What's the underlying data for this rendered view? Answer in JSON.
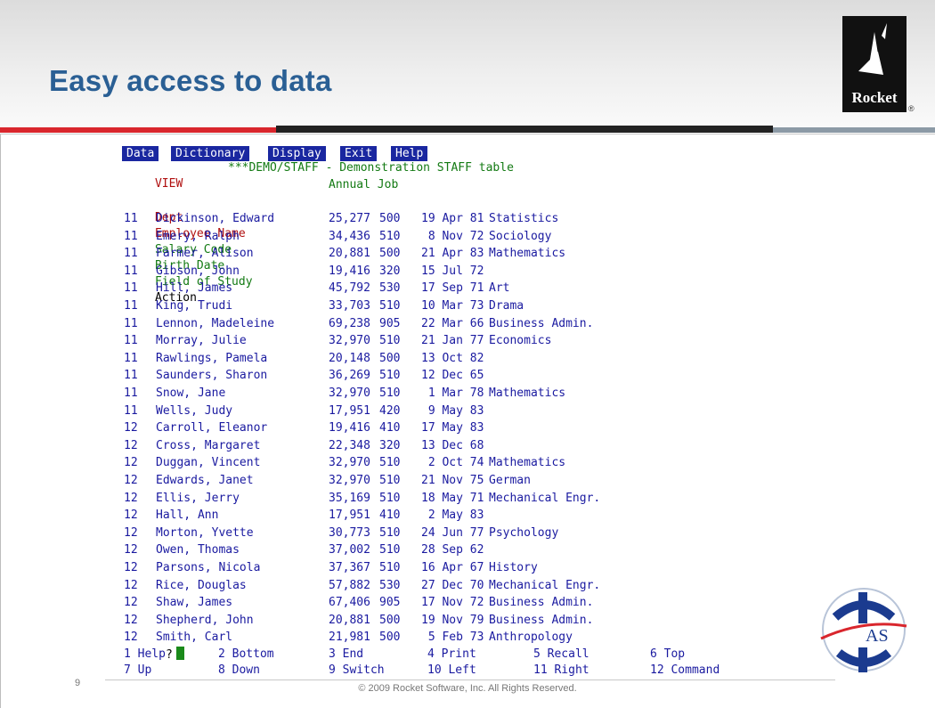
{
  "slide": {
    "title": "Easy access to data",
    "page_number": "9",
    "copyright": "© 2009 Rocket Software, Inc. All Rights Reserved.",
    "logo_text": "Rocket",
    "logo_mark": "®",
    "emblem_text": "AS"
  },
  "terminal": {
    "menu": [
      "Data",
      "Dictionary",
      "Display",
      "Exit",
      "Help"
    ],
    "mode": "VIEW",
    "table_title": "***DEMO/STAFF - Demonstration STAFF table",
    "header_top": "Annual Job",
    "columns": {
      "dept": "Dept",
      "name": "Employee Name",
      "salary_code": "Salary Code",
      "birth_date": "Birth Date",
      "field": "Field of Study",
      "action": "Action"
    },
    "rows": [
      {
        "dept": "11",
        "name": "Dickinson, Edward",
        "salary": "25,277",
        "code": "500",
        "birth": "19 Apr 81",
        "field": "Statistics"
      },
      {
        "dept": "11",
        "name": "Emery, Ralph",
        "salary": "34,436",
        "code": "510",
        "birth": " 8 Nov 72",
        "field": "Sociology"
      },
      {
        "dept": "11",
        "name": "Farmer, Alison",
        "salary": "20,881",
        "code": "500",
        "birth": "21 Apr 83",
        "field": "Mathematics"
      },
      {
        "dept": "11",
        "name": "Gibson, John",
        "salary": "19,416",
        "code": "320",
        "birth": "15 Jul 72",
        "field": ""
      },
      {
        "dept": "11",
        "name": "Hill, James",
        "salary": "45,792",
        "code": "530",
        "birth": "17 Sep 71",
        "field": "Art"
      },
      {
        "dept": "11",
        "name": "King, Trudi",
        "salary": "33,703",
        "code": "510",
        "birth": "10 Mar 73",
        "field": "Drama"
      },
      {
        "dept": "11",
        "name": "Lennon, Madeleine",
        "salary": "69,238",
        "code": "905",
        "birth": "22 Mar 66",
        "field": "Business Admin."
      },
      {
        "dept": "11",
        "name": "Morray, Julie",
        "salary": "32,970",
        "code": "510",
        "birth": "21 Jan 77",
        "field": "Economics"
      },
      {
        "dept": "11",
        "name": "Rawlings, Pamela",
        "salary": "20,148",
        "code": "500",
        "birth": "13 Oct 82",
        "field": ""
      },
      {
        "dept": "11",
        "name": "Saunders, Sharon",
        "salary": "36,269",
        "code": "510",
        "birth": "12 Dec 65",
        "field": ""
      },
      {
        "dept": "11",
        "name": "Snow, Jane",
        "salary": "32,970",
        "code": "510",
        "birth": " 1 Mar 78",
        "field": "Mathematics"
      },
      {
        "dept": "11",
        "name": "Wells, Judy",
        "salary": "17,951",
        "code": "420",
        "birth": " 9 May 83",
        "field": ""
      },
      {
        "dept": "12",
        "name": "Carroll, Eleanor",
        "salary": "19,416",
        "code": "410",
        "birth": "17 May 83",
        "field": ""
      },
      {
        "dept": "12",
        "name": "Cross, Margaret",
        "salary": "22,348",
        "code": "320",
        "birth": "13 Dec 68",
        "field": ""
      },
      {
        "dept": "12",
        "name": "Duggan, Vincent",
        "salary": "32,970",
        "code": "510",
        "birth": " 2 Oct 74",
        "field": "Mathematics"
      },
      {
        "dept": "12",
        "name": "Edwards, Janet",
        "salary": "32,970",
        "code": "510",
        "birth": "21 Nov 75",
        "field": "German"
      },
      {
        "dept": "12",
        "name": "Ellis, Jerry",
        "salary": "35,169",
        "code": "510",
        "birth": "18 May 71",
        "field": "Mechanical Engr."
      },
      {
        "dept": "12",
        "name": "Hall, Ann",
        "salary": "17,951",
        "code": "410",
        "birth": " 2 May 83",
        "field": ""
      },
      {
        "dept": "12",
        "name": "Morton, Yvette",
        "salary": "30,773",
        "code": "510",
        "birth": "24 Jun 77",
        "field": "Psychology"
      },
      {
        "dept": "12",
        "name": "Owen, Thomas",
        "salary": "37,002",
        "code": "510",
        "birth": "28 Sep 62",
        "field": ""
      },
      {
        "dept": "12",
        "name": "Parsons, Nicola",
        "salary": "37,367",
        "code": "510",
        "birth": "16 Apr 67",
        "field": "History"
      },
      {
        "dept": "12",
        "name": "Rice, Douglas",
        "salary": "57,882",
        "code": "530",
        "birth": "27 Dec 70",
        "field": "Mechanical Engr."
      },
      {
        "dept": "12",
        "name": "Shaw, James",
        "salary": "67,406",
        "code": "905",
        "birth": "17 Nov 72",
        "field": "Business Admin."
      },
      {
        "dept": "12",
        "name": "Shepherd, John",
        "salary": "20,881",
        "code": "500",
        "birth": "19 Nov 79",
        "field": "Business Admin."
      },
      {
        "dept": "12",
        "name": "Smith, Carl",
        "salary": "21,981",
        "code": "500",
        "birth": " 5 Feb 73",
        "field": "Anthropology"
      }
    ],
    "prompt": "?",
    "function_keys": [
      [
        "1 Help",
        "2 Bottom",
        "3 End",
        "4 Print",
        "5 Recall",
        "6 Top"
      ],
      [
        "7 Up",
        "8 Down",
        "9 Switch",
        "10 Left",
        "11 Right",
        "12 Command"
      ]
    ]
  },
  "colors": {
    "title": "#2a5f94",
    "menu_bg": "#1a27a0",
    "header_red": "#b01010",
    "header_green": "#137a13",
    "data_blue": "#1a1aa0",
    "cursor": "#1a8a1a",
    "rule_red": "#d9262d"
  }
}
